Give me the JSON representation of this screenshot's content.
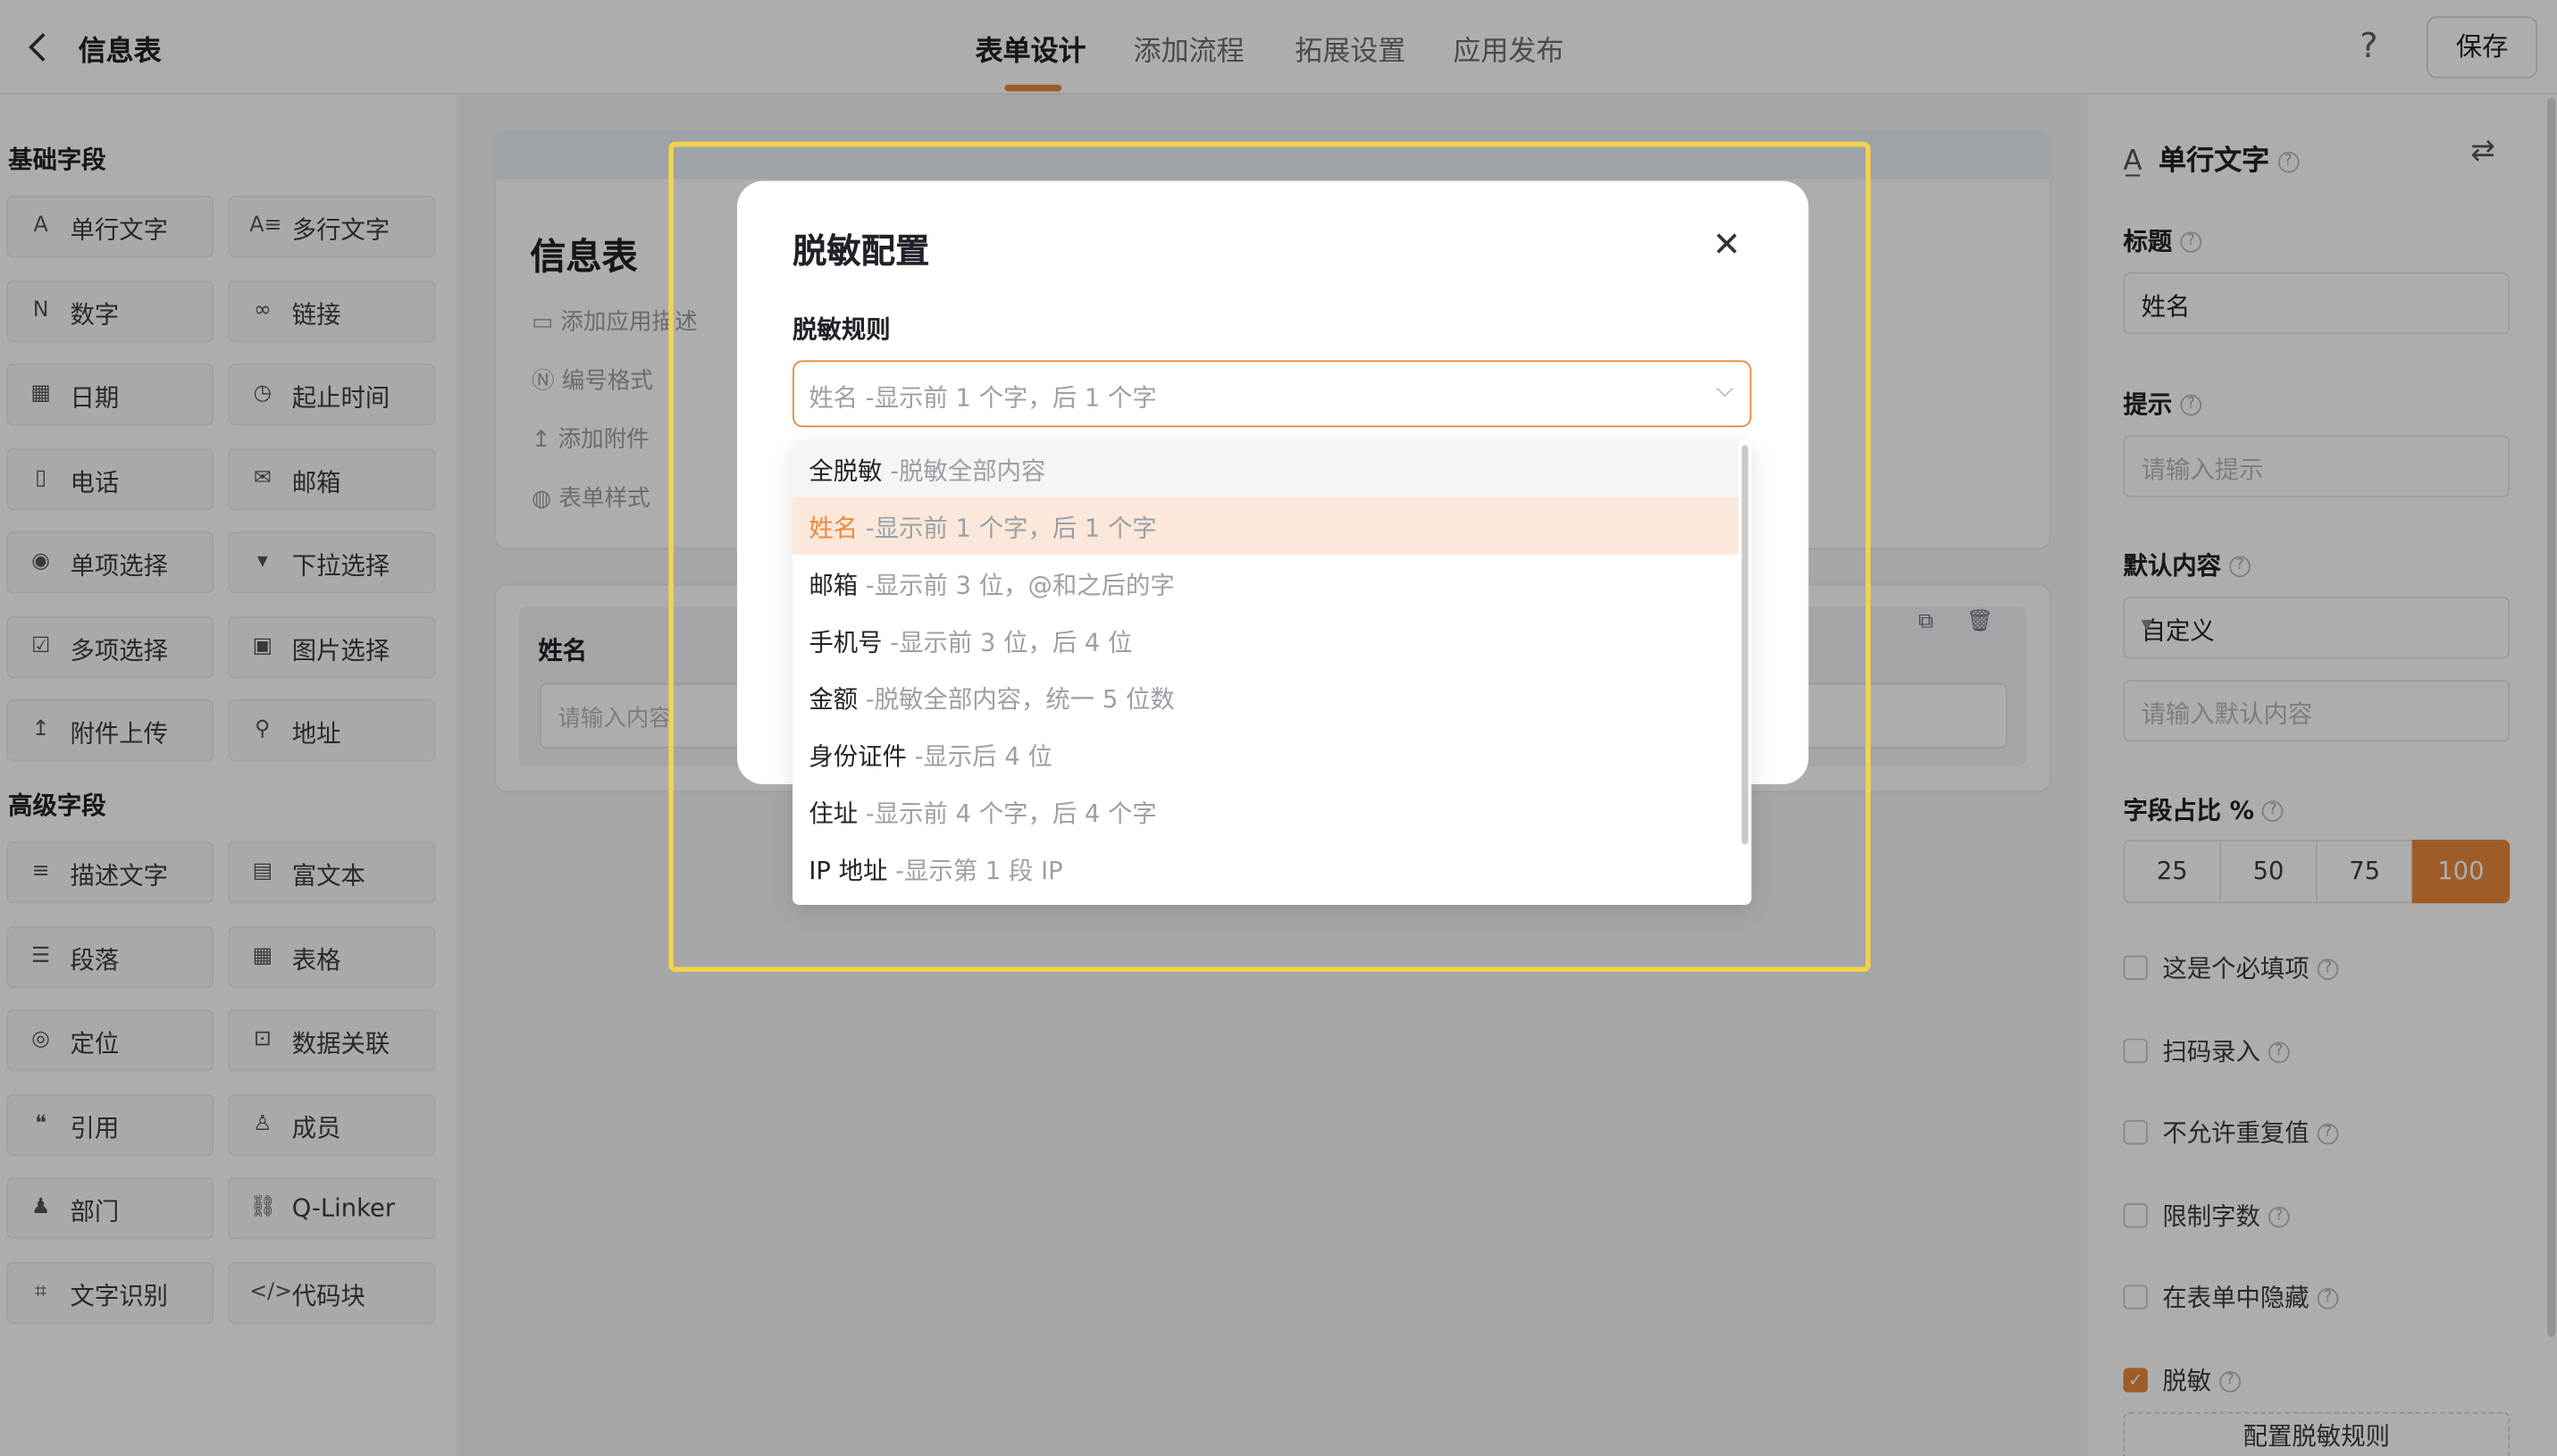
{
  "header": {
    "title": "信息表",
    "tabs": [
      "表单设计",
      "添加流程",
      "拓展设置",
      "应用发布"
    ],
    "active_tab": "表单设计",
    "help_icon": "?",
    "save_label": "保存"
  },
  "left_panel": {
    "basic_title": "基础字段",
    "basic_fields": [
      {
        "label": "单行文字",
        "icon": "A"
      },
      {
        "label": "多行文字",
        "icon": "A≡"
      },
      {
        "label": "数字",
        "icon": "N"
      },
      {
        "label": "链接",
        "icon": "∞"
      },
      {
        "label": "日期",
        "icon": "▦"
      },
      {
        "label": "起止时间",
        "icon": "◷"
      },
      {
        "label": "电话",
        "icon": "▯"
      },
      {
        "label": "邮箱",
        "icon": "✉"
      },
      {
        "label": "单项选择",
        "icon": "◉"
      },
      {
        "label": "下拉选择",
        "icon": "▾"
      },
      {
        "label": "多项选择",
        "icon": "☑"
      },
      {
        "label": "图片选择",
        "icon": "▣"
      },
      {
        "label": "附件上传",
        "icon": "↥"
      },
      {
        "label": "地址",
        "icon": "⚲"
      }
    ],
    "advanced_title": "高级字段",
    "advanced_fields": [
      {
        "label": "描述文字",
        "icon": "≡"
      },
      {
        "label": "富文本",
        "icon": "▤"
      },
      {
        "label": "段落",
        "icon": "☰"
      },
      {
        "label": "表格",
        "icon": "▦"
      },
      {
        "label": "定位",
        "icon": "◎"
      },
      {
        "label": "数据关联",
        "icon": "⊡"
      },
      {
        "label": "引用",
        "icon": "❝"
      },
      {
        "label": "成员",
        "icon": "♙"
      },
      {
        "label": "部门",
        "icon": "♟"
      },
      {
        "label": "Q-Linker",
        "icon": "⛓"
      },
      {
        "label": "文字识别",
        "icon": "⌗"
      },
      {
        "label": "代码块",
        "icon": "</>"
      }
    ]
  },
  "canvas": {
    "form_title": "信息表",
    "meta_items": [
      "添加应用描述",
      "编号格式",
      "添加附件",
      "表单样式"
    ],
    "field_label": "姓名",
    "field_placeholder": "请输入内容"
  },
  "right_panel": {
    "field_type": "单行文字",
    "title_label": "标题",
    "title_value": "姓名",
    "hint_label": "提示",
    "hint_placeholder": "请输入提示",
    "default_label": "默认内容",
    "default_mode": "自定义",
    "default_placeholder": "请输入默认内容",
    "ratio_label": "字段占比 %",
    "ratio_options": [
      "25",
      "50",
      "75",
      "100"
    ],
    "ratio_selected": "100",
    "checks": [
      {
        "label": "这是个必填项",
        "checked": false
      },
      {
        "label": "扫码录入",
        "checked": false
      },
      {
        "label": "不允许重复值",
        "checked": false
      },
      {
        "label": "限制字数",
        "checked": false
      },
      {
        "label": "在表单中隐藏",
        "checked": false
      },
      {
        "label": "脱敏",
        "checked": true
      }
    ],
    "config_button": "配置脱敏规则"
  },
  "modal": {
    "title": "脱敏配置",
    "rule_label": "脱敏规则",
    "selected_value": "姓名 -显示前 1 个字，后 1 个字",
    "options": [
      {
        "name": "全脱敏",
        "desc": "-脱敏全部内容"
      },
      {
        "name": "姓名",
        "desc": "-显示前 1 个字，后 1 个字"
      },
      {
        "name": "邮箱",
        "desc": "-显示前 3 位，@和之后的字"
      },
      {
        "name": "手机号",
        "desc": "-显示前 3 位，后 4 位"
      },
      {
        "name": "金额",
        "desc": "-脱敏全部内容，统一 5 位数"
      },
      {
        "name": "身份证件",
        "desc": "-显示后 4 位"
      },
      {
        "name": "住址",
        "desc": "-显示前 4 个字，后 4 个字"
      },
      {
        "name": "IP 地址",
        "desc": "-显示第 1 段 IP"
      }
    ],
    "selected_option": "姓名",
    "hovered_option": "全脱敏"
  },
  "colors": {
    "accent": "#e98a3c",
    "highlight_border": "#f4d34a"
  }
}
